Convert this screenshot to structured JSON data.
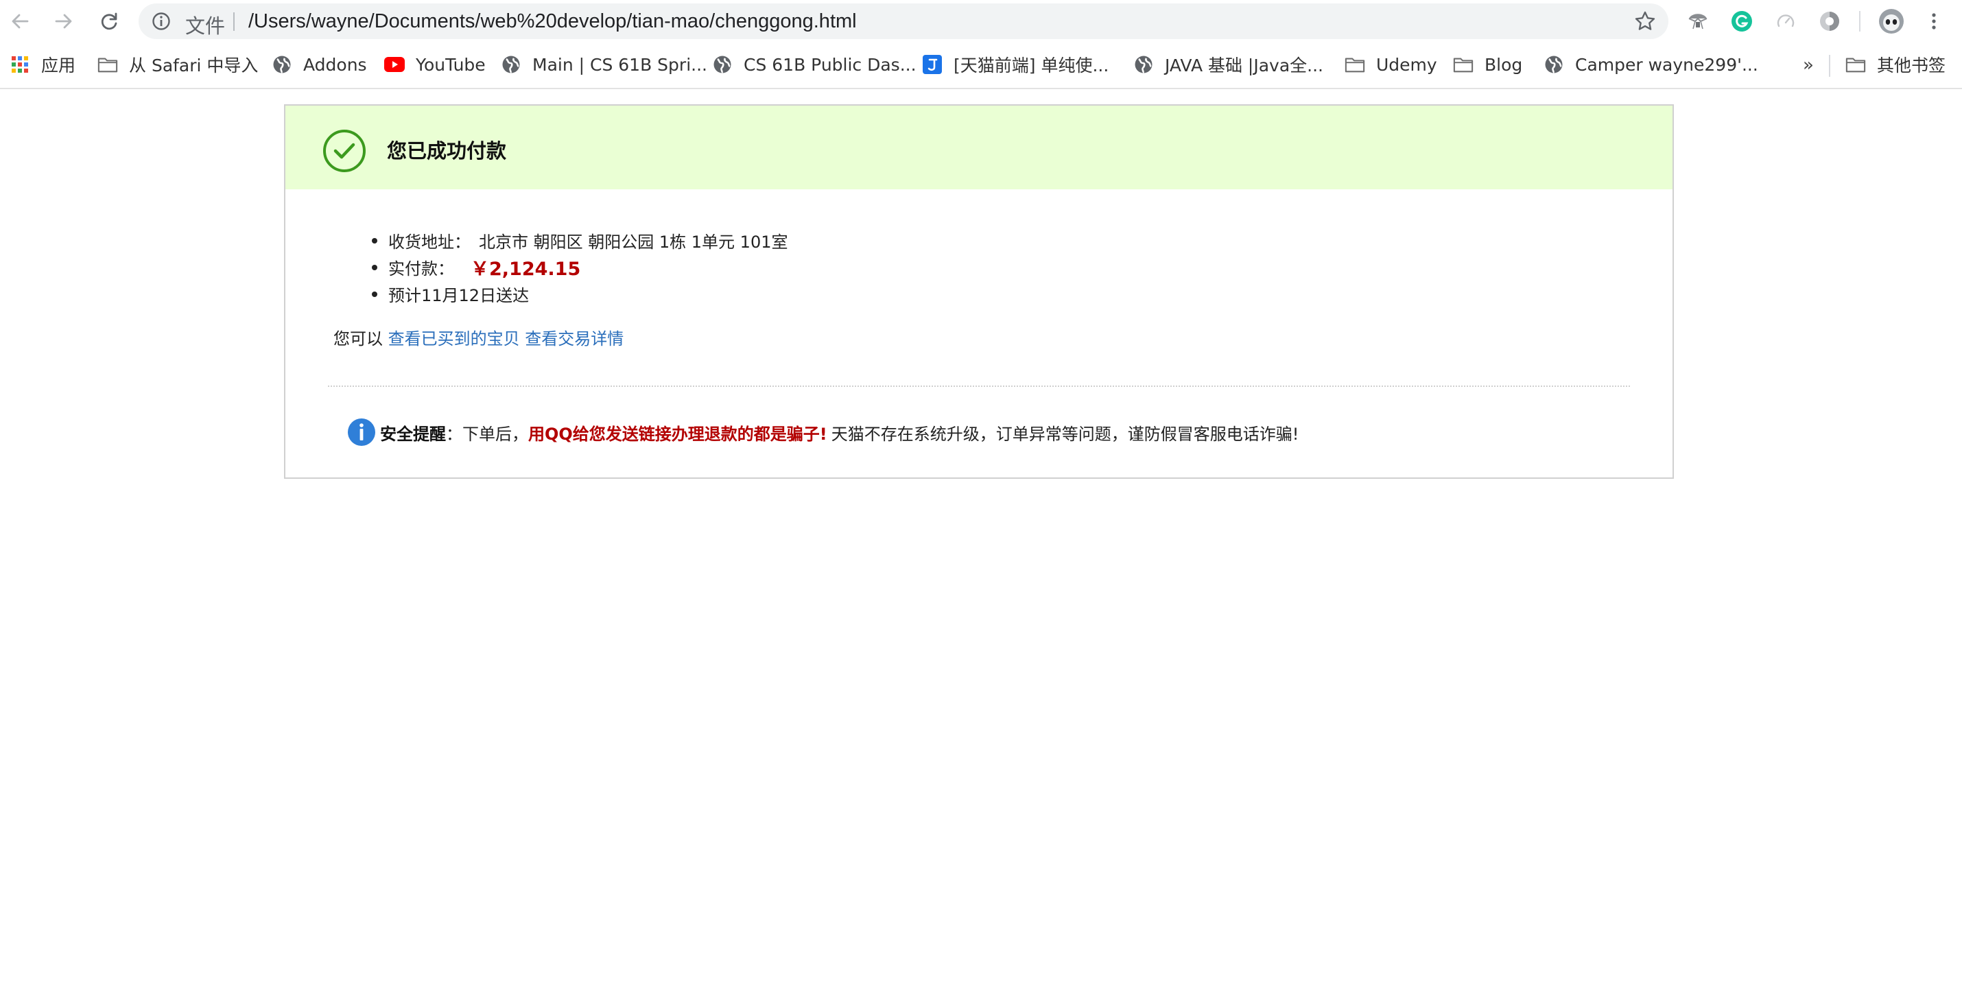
{
  "browser": {
    "omnibox": {
      "security_label": "文件",
      "url": "/Users/wayne/Documents/web%20develop/tian-mao/chenggong.html"
    },
    "extensions": [
      "shield-extension-icon",
      "grammarly-extension-icon",
      "speed-extension-icon",
      "dark-mode-extension-icon",
      "profile-avatar"
    ],
    "colors": {
      "grammarly": "#15c39a",
      "youtube": "#ff0000",
      "jmooc": "#1a73e8"
    }
  },
  "bookmarks": {
    "items": [
      {
        "label": "应用",
        "icon": "apps-grid-icon"
      },
      {
        "label": "从 Safari 中导入",
        "icon": "folder-icon"
      },
      {
        "label": "Addons",
        "icon": "globe-icon"
      },
      {
        "label": "YouTube",
        "icon": "youtube-icon"
      },
      {
        "label": "Main | CS 61B Spri...",
        "icon": "globe-icon"
      },
      {
        "label": "CS 61B Public Das...",
        "icon": "globe-icon"
      },
      {
        "label": "[天猫前端] 单纯使...",
        "icon": "j-site-icon"
      },
      {
        "label": "JAVA 基础 |Java全...",
        "icon": "globe-icon"
      },
      {
        "label": "Udemy",
        "icon": "folder-icon"
      },
      {
        "label": "Blog",
        "icon": "folder-icon"
      },
      {
        "label": "Camper wayne299'...",
        "icon": "globe-icon"
      }
    ],
    "more": "»",
    "other": {
      "label": "其他书签",
      "icon": "folder-icon"
    }
  },
  "page": {
    "banner": {
      "title": "您已成功付款",
      "bg_color": "#eaffd4",
      "check_color": "#3c9a1e"
    },
    "info": {
      "address_label": "收货地址：",
      "address": "北京市 朝阳区 朝阳公园 1栋 1单元 101室",
      "paid_label": "实付款：",
      "paid_amount": "￥2,124.15",
      "delivery": "预计11月12日送达"
    },
    "links": {
      "prefix": "您可以",
      "view_bought": "查看已买到的宝贝",
      "view_detail": "查看交易详情"
    },
    "warning": {
      "title": "安全提醒",
      "colon": "：",
      "part1": "下单后，",
      "red": "用QQ给您发送链接办理退款的都是骗子!",
      "part2": "天猫不存在系统升级，订单异常等问题，谨防假冒客服电话诈骗!"
    }
  }
}
